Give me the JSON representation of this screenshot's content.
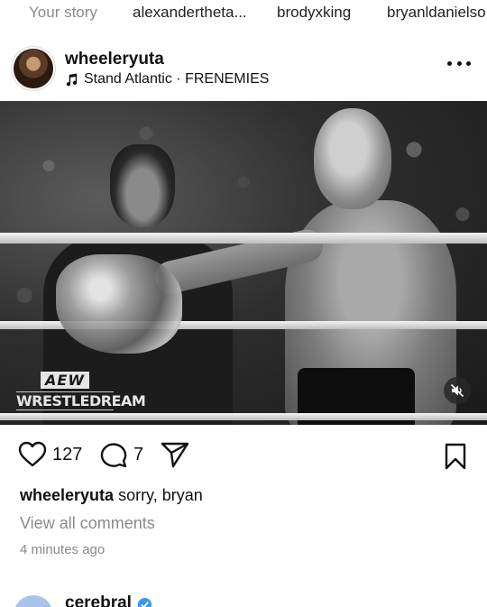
{
  "stories": [
    {
      "name": "Your story"
    },
    {
      "name": "alexandertheta..."
    },
    {
      "name": "brodyxking"
    },
    {
      "name": "bryanldanielso"
    }
  ],
  "post": {
    "username": "wheeleryuta",
    "music": "Stand Atlantic · FRENEMIES",
    "image_logo_top": "AEW",
    "image_logo_bottom": "WRESTLEDREAM",
    "likes": "127",
    "comments": "7",
    "caption_user": "wheeleryuta",
    "caption_text": "sorry, bryan",
    "view_comments": "View all comments",
    "timestamp": "4 minutes ago"
  },
  "next_post": {
    "username": "cerebral"
  },
  "icons": {
    "music": "music-note-icon",
    "more": "more-horizontal-icon",
    "mute": "muted-speaker-icon",
    "like": "heart-icon",
    "comment": "comment-icon",
    "share": "send-icon",
    "save": "bookmark-icon",
    "verified": "verified-badge-icon"
  },
  "colors": {
    "text": "#111111",
    "muted": "#8a8a8a",
    "verified": "#3897f0"
  }
}
